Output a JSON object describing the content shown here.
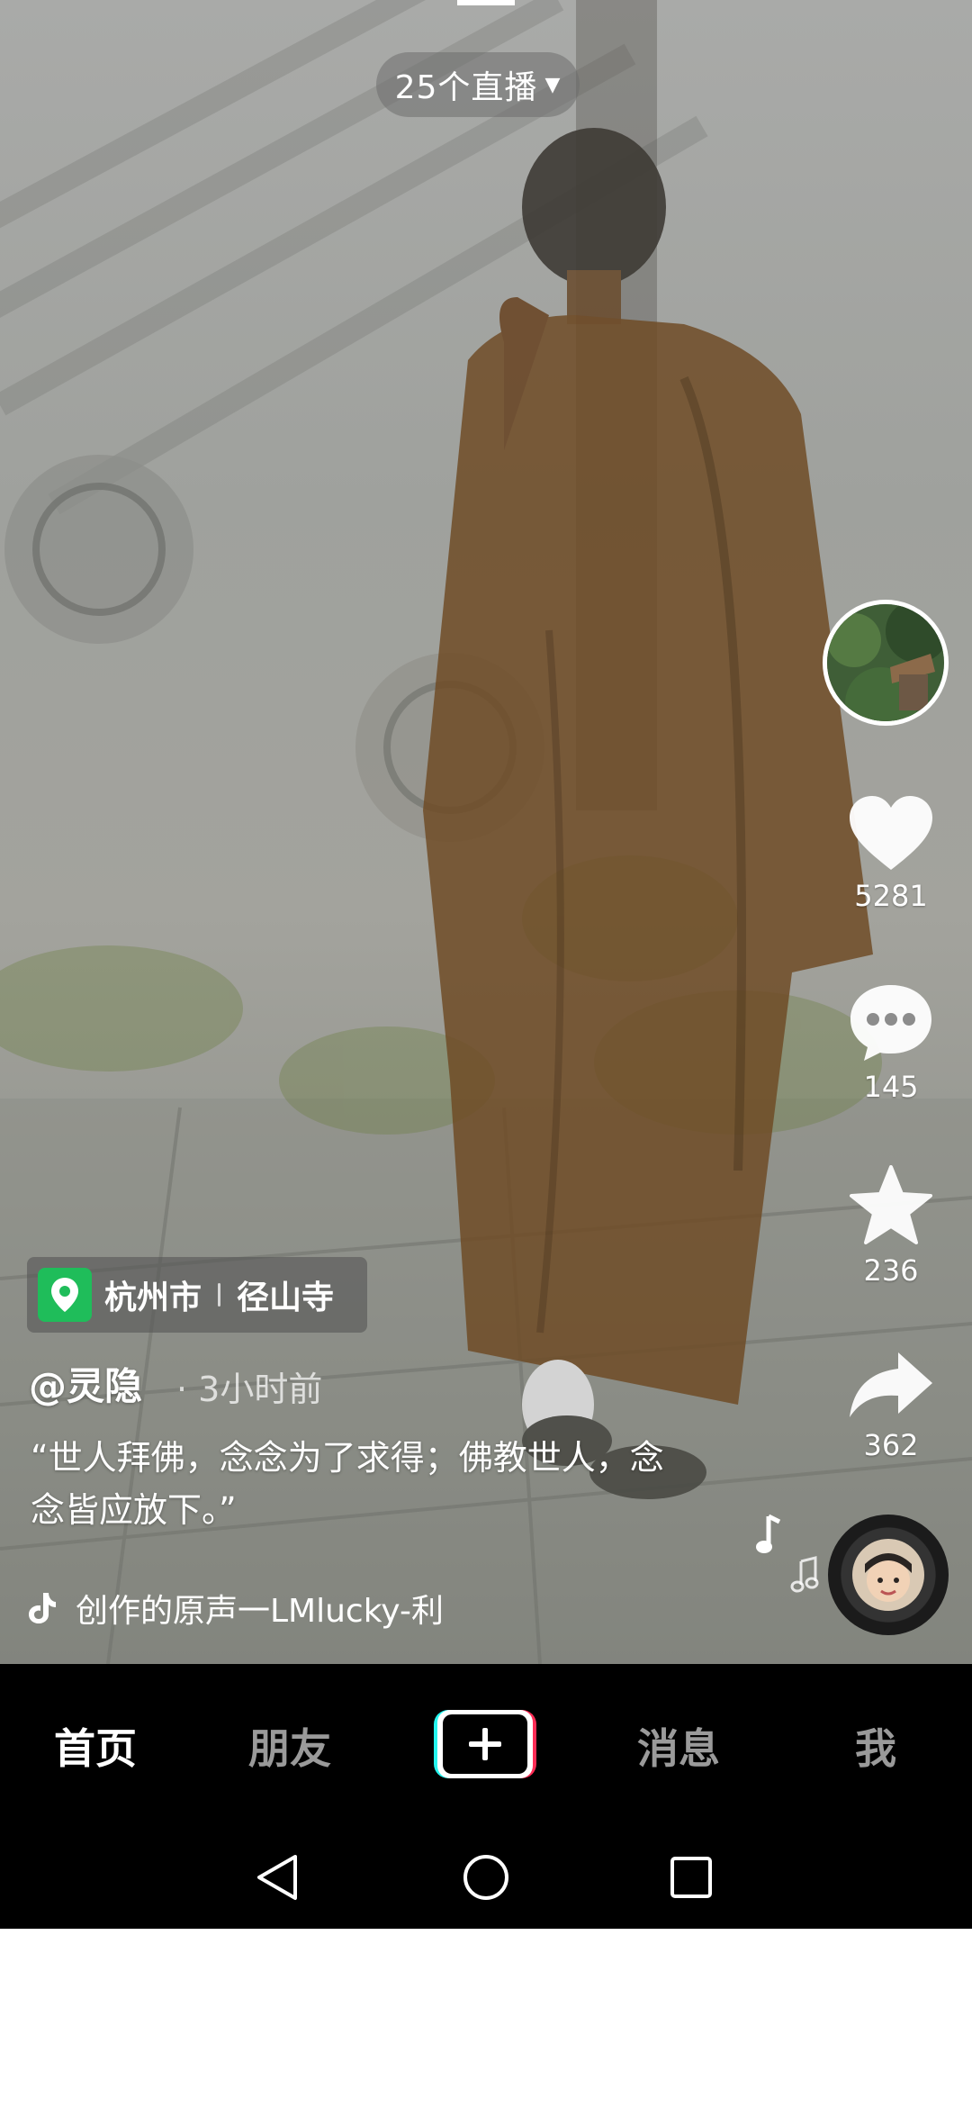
{
  "top": {
    "live_label": "25个直播"
  },
  "actions": {
    "like_count": "5281",
    "comment_count": "145",
    "favorite_count": "236",
    "share_count": "362"
  },
  "post": {
    "location_city": "杭州市",
    "location_place": "径山寺",
    "author": "@灵隐",
    "time": "· 3小时前",
    "caption": "“世人拜佛，念念为了求得；佛教世人，念念皆应放下。”",
    "music": "创作的原声一LMlucky-利"
  },
  "tabs": [
    {
      "label": "首页"
    },
    {
      "label": "朋友"
    },
    {
      "label": "消息"
    },
    {
      "label": "我"
    }
  ],
  "colors": {
    "accent_green": "#1fbd5a",
    "tab_active": "#ffffff",
    "tab_inactive": "#9a9a9a",
    "plus_cyan": "#25f4ee",
    "plus_red": "#fe2c55"
  }
}
